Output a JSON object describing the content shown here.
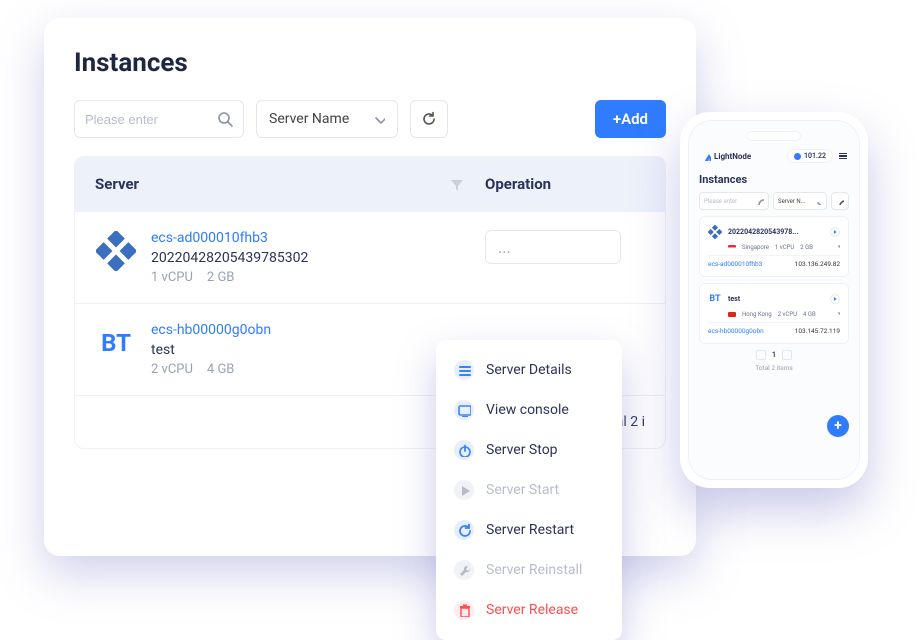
{
  "page_title": "Instances",
  "toolbar": {
    "search_placeholder": "Please enter",
    "select_label": "Server Name",
    "add_label": "+Add"
  },
  "table": {
    "header_server": "Server",
    "header_op": "Operation",
    "rows": [
      {
        "os_kind": "centos",
        "link": "ecs-ad000010fhb3",
        "name": "20220428205439785302",
        "cpu": "1 vCPU",
        "ram": "2 GB"
      },
      {
        "os_kind": "bt",
        "os_text": "BT",
        "link": "ecs-hb00000g0obn",
        "name": "test",
        "cpu": "2 vCPU",
        "ram": "4 GB"
      }
    ],
    "op_dots": "...",
    "footer_text": "Total 2 i"
  },
  "action_menu": [
    {
      "label": "Server Details",
      "state": "normal",
      "icon": "list"
    },
    {
      "label": "View console",
      "state": "normal",
      "icon": "console"
    },
    {
      "label": "Server Stop",
      "state": "normal",
      "icon": "power"
    },
    {
      "label": "Server Start",
      "state": "disabled",
      "icon": "play"
    },
    {
      "label": "Server Restart",
      "state": "normal",
      "icon": "restart"
    },
    {
      "label": "Server Reinstall",
      "state": "disabled",
      "icon": "wrench"
    },
    {
      "label": "Server Release",
      "state": "danger",
      "icon": "trash"
    }
  ],
  "phone": {
    "brand": "LightNode",
    "balance": "101.22",
    "title": "Instances",
    "search_placeholder": "Please enter",
    "select_label": "Server N...",
    "cards": [
      {
        "os_kind": "centos",
        "name": "2022042820543978...",
        "region_flag": "sg",
        "region": "Singapore",
        "cpu": "1 vCPU",
        "ram": "2 GB",
        "link": "ecs-ad000010fhb3",
        "ip": "103.136.249.82"
      },
      {
        "os_kind": "bt",
        "os_text": "BT",
        "name": "test",
        "region_flag": "hk",
        "region": "Hong Kong",
        "cpu": "2 vCPU",
        "ram": "4 GB",
        "link": "ecs-hb00000g0obn",
        "ip": "103.145.72.119"
      }
    ],
    "page_num": "1",
    "total_text": "Total 2 items"
  }
}
